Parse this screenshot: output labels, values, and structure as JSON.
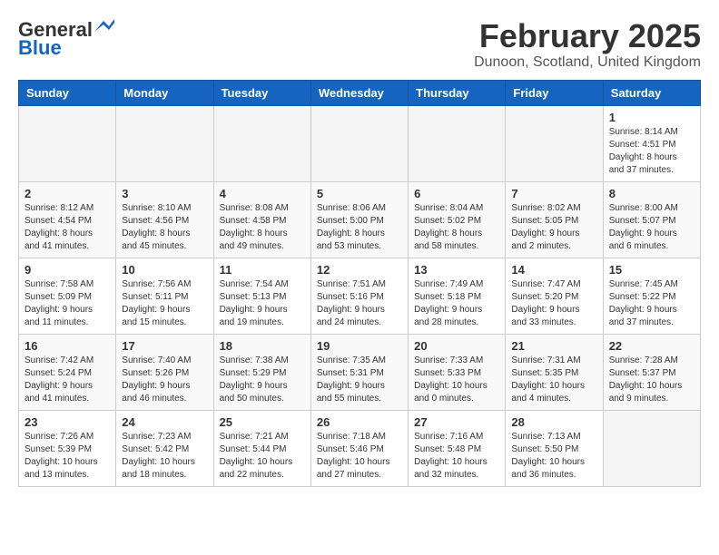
{
  "header": {
    "logo_line1": "General",
    "logo_line2": "Blue",
    "title": "February 2025",
    "subtitle": "Dunoon, Scotland, United Kingdom"
  },
  "weekdays": [
    "Sunday",
    "Monday",
    "Tuesday",
    "Wednesday",
    "Thursday",
    "Friday",
    "Saturday"
  ],
  "weeks": [
    [
      {
        "day": "",
        "info": ""
      },
      {
        "day": "",
        "info": ""
      },
      {
        "day": "",
        "info": ""
      },
      {
        "day": "",
        "info": ""
      },
      {
        "day": "",
        "info": ""
      },
      {
        "day": "",
        "info": ""
      },
      {
        "day": "1",
        "info": "Sunrise: 8:14 AM\nSunset: 4:51 PM\nDaylight: 8 hours and 37 minutes."
      }
    ],
    [
      {
        "day": "2",
        "info": "Sunrise: 8:12 AM\nSunset: 4:54 PM\nDaylight: 8 hours and 41 minutes."
      },
      {
        "day": "3",
        "info": "Sunrise: 8:10 AM\nSunset: 4:56 PM\nDaylight: 8 hours and 45 minutes."
      },
      {
        "day": "4",
        "info": "Sunrise: 8:08 AM\nSunset: 4:58 PM\nDaylight: 8 hours and 49 minutes."
      },
      {
        "day": "5",
        "info": "Sunrise: 8:06 AM\nSunset: 5:00 PM\nDaylight: 8 hours and 53 minutes."
      },
      {
        "day": "6",
        "info": "Sunrise: 8:04 AM\nSunset: 5:02 PM\nDaylight: 8 hours and 58 minutes."
      },
      {
        "day": "7",
        "info": "Sunrise: 8:02 AM\nSunset: 5:05 PM\nDaylight: 9 hours and 2 minutes."
      },
      {
        "day": "8",
        "info": "Sunrise: 8:00 AM\nSunset: 5:07 PM\nDaylight: 9 hours and 6 minutes."
      }
    ],
    [
      {
        "day": "9",
        "info": "Sunrise: 7:58 AM\nSunset: 5:09 PM\nDaylight: 9 hours and 11 minutes."
      },
      {
        "day": "10",
        "info": "Sunrise: 7:56 AM\nSunset: 5:11 PM\nDaylight: 9 hours and 15 minutes."
      },
      {
        "day": "11",
        "info": "Sunrise: 7:54 AM\nSunset: 5:13 PM\nDaylight: 9 hours and 19 minutes."
      },
      {
        "day": "12",
        "info": "Sunrise: 7:51 AM\nSunset: 5:16 PM\nDaylight: 9 hours and 24 minutes."
      },
      {
        "day": "13",
        "info": "Sunrise: 7:49 AM\nSunset: 5:18 PM\nDaylight: 9 hours and 28 minutes."
      },
      {
        "day": "14",
        "info": "Sunrise: 7:47 AM\nSunset: 5:20 PM\nDaylight: 9 hours and 33 minutes."
      },
      {
        "day": "15",
        "info": "Sunrise: 7:45 AM\nSunset: 5:22 PM\nDaylight: 9 hours and 37 minutes."
      }
    ],
    [
      {
        "day": "16",
        "info": "Sunrise: 7:42 AM\nSunset: 5:24 PM\nDaylight: 9 hours and 41 minutes."
      },
      {
        "day": "17",
        "info": "Sunrise: 7:40 AM\nSunset: 5:26 PM\nDaylight: 9 hours and 46 minutes."
      },
      {
        "day": "18",
        "info": "Sunrise: 7:38 AM\nSunset: 5:29 PM\nDaylight: 9 hours and 50 minutes."
      },
      {
        "day": "19",
        "info": "Sunrise: 7:35 AM\nSunset: 5:31 PM\nDaylight: 9 hours and 55 minutes."
      },
      {
        "day": "20",
        "info": "Sunrise: 7:33 AM\nSunset: 5:33 PM\nDaylight: 10 hours and 0 minutes."
      },
      {
        "day": "21",
        "info": "Sunrise: 7:31 AM\nSunset: 5:35 PM\nDaylight: 10 hours and 4 minutes."
      },
      {
        "day": "22",
        "info": "Sunrise: 7:28 AM\nSunset: 5:37 PM\nDaylight: 10 hours and 9 minutes."
      }
    ],
    [
      {
        "day": "23",
        "info": "Sunrise: 7:26 AM\nSunset: 5:39 PM\nDaylight: 10 hours and 13 minutes."
      },
      {
        "day": "24",
        "info": "Sunrise: 7:23 AM\nSunset: 5:42 PM\nDaylight: 10 hours and 18 minutes."
      },
      {
        "day": "25",
        "info": "Sunrise: 7:21 AM\nSunset: 5:44 PM\nDaylight: 10 hours and 22 minutes."
      },
      {
        "day": "26",
        "info": "Sunrise: 7:18 AM\nSunset: 5:46 PM\nDaylight: 10 hours and 27 minutes."
      },
      {
        "day": "27",
        "info": "Sunrise: 7:16 AM\nSunset: 5:48 PM\nDaylight: 10 hours and 32 minutes."
      },
      {
        "day": "28",
        "info": "Sunrise: 7:13 AM\nSunset: 5:50 PM\nDaylight: 10 hours and 36 minutes."
      },
      {
        "day": "",
        "info": ""
      }
    ]
  ]
}
